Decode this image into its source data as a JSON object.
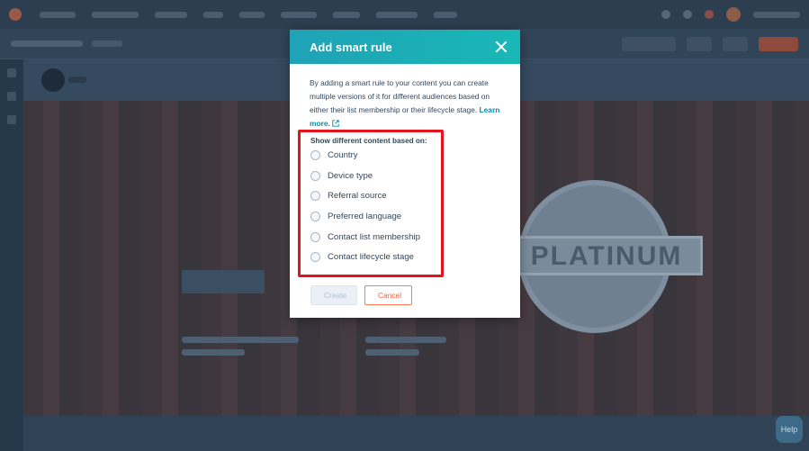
{
  "modal": {
    "title": "Add smart rule",
    "description": "By adding a smart rule to your content you can create multiple versions of it for different audiences based on either their list membership or their lifecycle stage.",
    "learn_more": "Learn more.",
    "options_label": "Show different content based on:",
    "options": [
      {
        "label": "Country",
        "selected": false
      },
      {
        "label": "Device type",
        "selected": false
      },
      {
        "label": "Referral source",
        "selected": false
      },
      {
        "label": "Preferred language",
        "selected": false
      },
      {
        "label": "Contact list membership",
        "selected": false
      },
      {
        "label": "Contact lifecycle stage",
        "selected": false
      }
    ],
    "create_label": "Create",
    "cancel_label": "Cancel"
  },
  "background": {
    "badge_text": "PLATINUM",
    "help_label": "Help"
  },
  "colors": {
    "header_gradient_start": "#1fa2b6",
    "header_gradient_end": "#19b8b6",
    "link": "#0091ae",
    "cancel_accent": "#ff5c35",
    "highlight_box": "#e3141b"
  }
}
